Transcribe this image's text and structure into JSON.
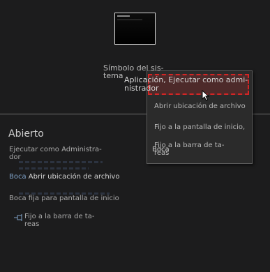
{
  "app": {
    "title": "Símbolo del sis-\ntema"
  },
  "jumplist": {
    "heading": "Abierto",
    "tasks": {
      "run_admin": "Ejecutar como Administra-\ndor",
      "open_location_prefix": "Boca",
      "open_location": "Abrir ubicación de archivo",
      "pin_start": "Boca fija para pantalla de inicio",
      "pin_taskbar": "Fijo a la barra de ta-\nreas"
    }
  },
  "context_menu": {
    "title": "Aplicación, Ejecutar como admi-\nnistrador",
    "items": {
      "open_location": "Abrir ubicación de archivo",
      "pin_start": "Fijo a la pantalla de inicio,",
      "pin_taskbar": "Fijo a la barra de ta-\nreas"
    },
    "overlap_label": "Boca"
  },
  "colors": {
    "background": "#1c1c1d",
    "menu_bg": "#2b2b2b",
    "highlight_border": "#d42525",
    "link_blue": "#7fa2c8"
  },
  "icons": {
    "app": "command-prompt-icon",
    "pin": "pin-icon",
    "cursor": "mouse-cursor-icon"
  }
}
